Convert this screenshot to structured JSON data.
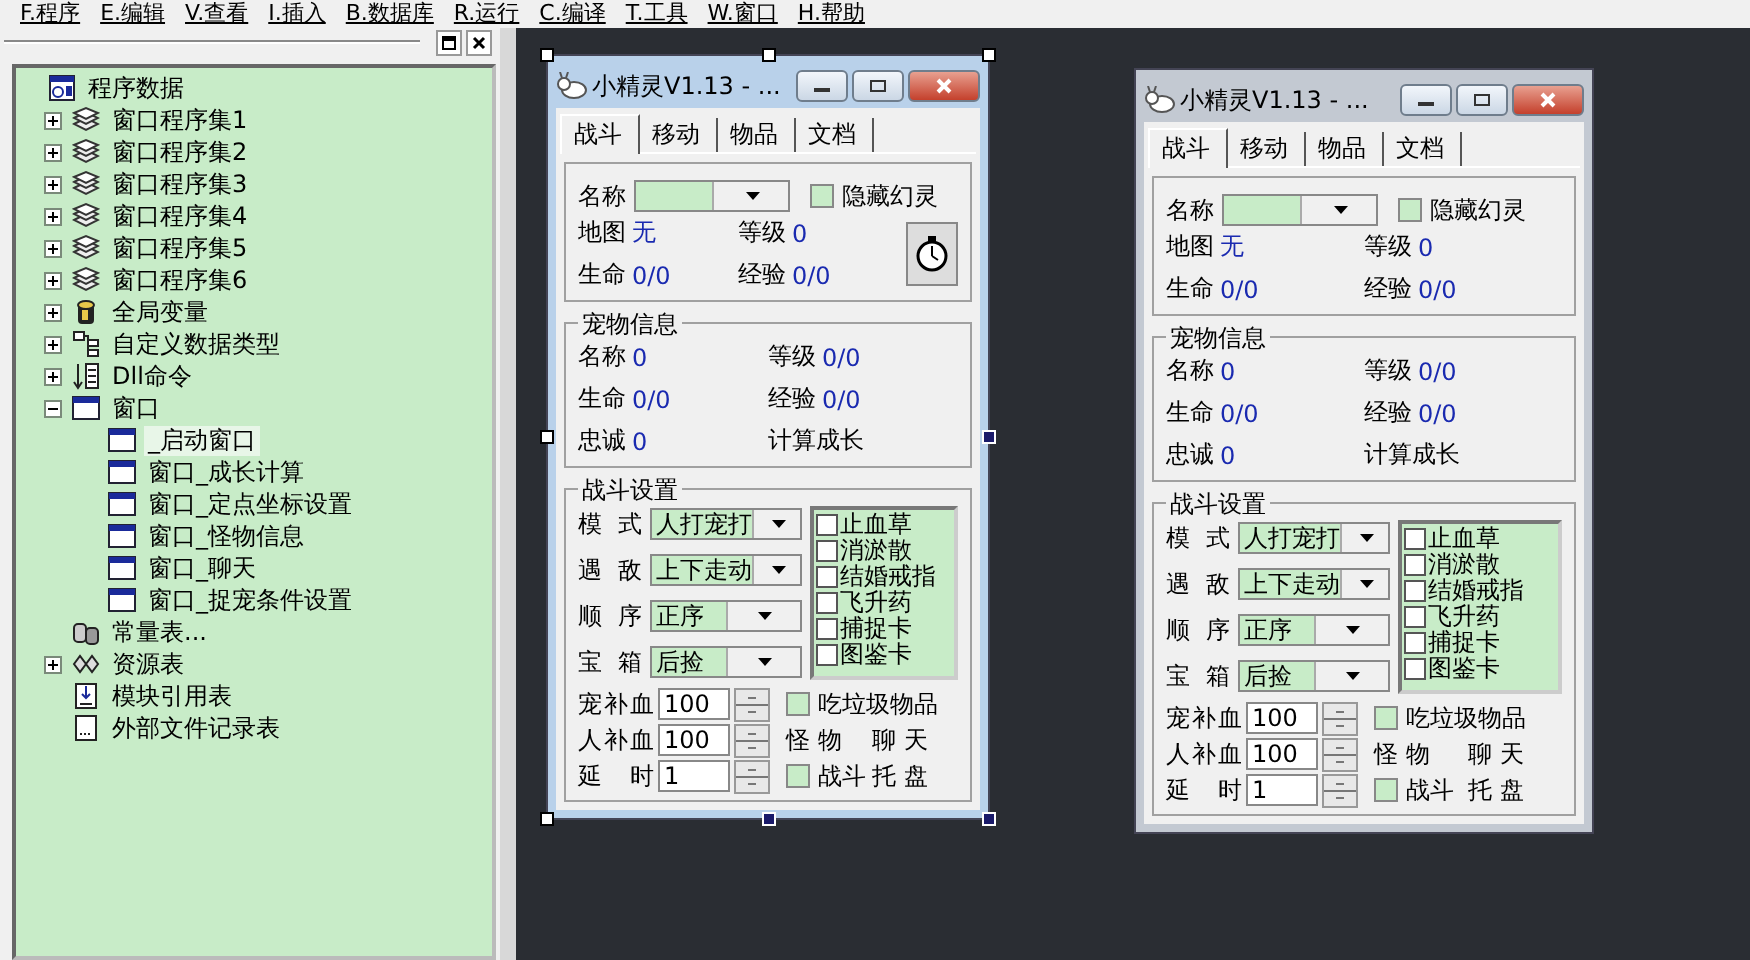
{
  "menu_bar": [
    "F.程序",
    "E.编辑",
    "V.查看",
    "I.插入",
    "B.数据库",
    "R.运行",
    "C.编译",
    "T.工具",
    "W.窗口",
    "H.帮助"
  ],
  "tree": {
    "items": [
      {
        "label": "程序数据",
        "kind": "root",
        "selected": false,
        "children": [
          {
            "label": "窗口程序集1",
            "kind": "assembly",
            "expanded": false,
            "selected": false
          },
          {
            "label": "窗口程序集2",
            "kind": "assembly",
            "expanded": false,
            "selected": false
          },
          {
            "label": "窗口程序集3",
            "kind": "assembly",
            "expanded": false,
            "selected": false
          },
          {
            "label": "窗口程序集4",
            "kind": "assembly",
            "expanded": false,
            "selected": false
          },
          {
            "label": "窗口程序集5",
            "kind": "assembly",
            "expanded": false,
            "selected": false
          },
          {
            "label": "窗口程序集6",
            "kind": "assembly",
            "expanded": false,
            "selected": false
          },
          {
            "label": "全局变量",
            "kind": "variable",
            "expanded": false,
            "selected": false
          },
          {
            "label": "自定义数据类型",
            "kind": "datatype",
            "expanded": false,
            "selected": false
          },
          {
            "label": "Dll命令",
            "kind": "dll",
            "expanded": false,
            "selected": false
          },
          {
            "label": "窗口",
            "kind": "window",
            "expanded": true,
            "selected": false,
            "children": [
              {
                "label": "_启动窗口",
                "kind": "window",
                "selected": true
              },
              {
                "label": "窗口_成长计算",
                "kind": "window",
                "selected": false
              },
              {
                "label": "窗口_定点坐标设置",
                "kind": "window",
                "selected": false
              },
              {
                "label": "窗口_怪物信息",
                "kind": "window",
                "selected": false
              },
              {
                "label": "窗口_聊天",
                "kind": "window",
                "selected": false
              },
              {
                "label": "窗口_捉宠条件设置",
                "kind": "window",
                "selected": false
              }
            ]
          },
          {
            "label": "常量表...",
            "kind": "constant",
            "selected": false
          },
          {
            "label": "资源表",
            "kind": "resource",
            "expanded": false,
            "selected": false
          },
          {
            "label": "模块引用表",
            "kind": "module",
            "selected": false
          },
          {
            "label": "外部文件记录表",
            "kind": "file",
            "selected": false
          }
        ]
      }
    ]
  },
  "windows": [
    {
      "kind": "design",
      "title": "小精灵V1.13 - ...",
      "tabs": [
        {
          "label": "战斗",
          "selected": true
        },
        {
          "label": "移动",
          "selected": false
        },
        {
          "label": "物品",
          "selected": false
        },
        {
          "label": "文档",
          "selected": false
        }
      ],
      "role": {
        "name_label": "名称",
        "hide_checkbox": {
          "label": "隐藏幻灵",
          "checked": false
        },
        "fields": [
          {
            "label": "地图",
            "value": "无"
          },
          {
            "label": "等级",
            "value": "0"
          },
          {
            "label": "生命",
            "value": "0/0"
          },
          {
            "label": "经验",
            "value": "0/0"
          }
        ]
      },
      "pet": {
        "title": "宠物信息",
        "fields": [
          {
            "label": "名称",
            "value": "0"
          },
          {
            "label": "等级",
            "value": "0/0"
          },
          {
            "label": "生命",
            "value": "0/0"
          },
          {
            "label": "经验",
            "value": "0/0"
          },
          {
            "label": "忠诚",
            "value": "0"
          },
          {
            "label": "计算成长"
          }
        ]
      },
      "battle": {
        "title": "战斗设置",
        "combos": [
          {
            "label": "模 式",
            "value": "人打宠打"
          },
          {
            "label": "遇 敌",
            "value": "上下走动"
          },
          {
            "label": "顺 序",
            "value": "正序"
          },
          {
            "label": "宝 箱",
            "value": "后捡"
          }
        ],
        "items": [
          {
            "label": "止血草",
            "checked": false
          },
          {
            "label": "消淤散",
            "checked": false
          },
          {
            "label": "结婚戒指",
            "checked": false
          },
          {
            "label": "飞升药",
            "checked": false
          },
          {
            "label": "捕捉卡",
            "checked": false
          },
          {
            "label": "图鉴卡",
            "checked": false
          }
        ],
        "spinners": [
          {
            "label": "宠补血",
            "value": "100"
          },
          {
            "label": "人补血",
            "value": "100"
          },
          {
            "label": "延 时",
            "value": "1"
          }
        ],
        "options": [
          {
            "kind": "checkbox",
            "label": "吃垃圾物品",
            "checked": false
          },
          {
            "kind": "text",
            "label": "怪 物"
          },
          {
            "kind": "text",
            "label": "聊 天"
          },
          {
            "kind": "checkbox",
            "label": "战斗",
            "checked": false
          },
          {
            "kind": "text",
            "label": "托 盘"
          }
        ]
      }
    },
    {
      "kind": "running",
      "title": "小精灵V1.13 - ...",
      "tabs": [
        {
          "label": "战斗",
          "selected": true
        },
        {
          "label": "移动",
          "selected": false
        },
        {
          "label": "物品",
          "selected": false
        },
        {
          "label": "文档",
          "selected": false
        }
      ],
      "role": {
        "name_label": "名称",
        "hide_checkbox": {
          "label": "隐藏幻灵",
          "checked": false
        },
        "fields": [
          {
            "label": "地图",
            "value": "无"
          },
          {
            "label": "等级",
            "value": "0"
          },
          {
            "label": "生命",
            "value": "0/0"
          },
          {
            "label": "经验",
            "value": "0/0"
          }
        ]
      },
      "pet": {
        "title": "宠物信息",
        "fields": [
          {
            "label": "名称",
            "value": "0"
          },
          {
            "label": "等级",
            "value": "0/0"
          },
          {
            "label": "生命",
            "value": "0/0"
          },
          {
            "label": "经验",
            "value": "0/0"
          },
          {
            "label": "忠诚",
            "value": "0"
          },
          {
            "label": "计算成长"
          }
        ]
      },
      "battle": {
        "title": "战斗设置",
        "combos": [
          {
            "label": "模 式",
            "value": "人打宠打"
          },
          {
            "label": "遇 敌",
            "value": "上下走动"
          },
          {
            "label": "顺 序",
            "value": "正序"
          },
          {
            "label": "宝 箱",
            "value": "后捡"
          }
        ],
        "items": [
          {
            "label": "止血草",
            "checked": false
          },
          {
            "label": "消淤散",
            "checked": false
          },
          {
            "label": "结婚戒指",
            "checked": false
          },
          {
            "label": "飞升药",
            "checked": false
          },
          {
            "label": "捕捉卡",
            "checked": false
          },
          {
            "label": "图鉴卡",
            "checked": false
          }
        ],
        "spinners": [
          {
            "label": "宠补血",
            "value": "100"
          },
          {
            "label": "人补血",
            "value": "100"
          },
          {
            "label": "延 时",
            "value": "1"
          }
        ],
        "options": [
          {
            "kind": "checkbox",
            "label": "吃垃圾物品",
            "checked": false
          },
          {
            "kind": "text",
            "label": "怪 物"
          },
          {
            "kind": "text",
            "label": "聊 天"
          },
          {
            "kind": "checkbox",
            "label": "战斗",
            "checked": false
          },
          {
            "kind": "text",
            "label": "托 盘"
          }
        ]
      }
    }
  ]
}
